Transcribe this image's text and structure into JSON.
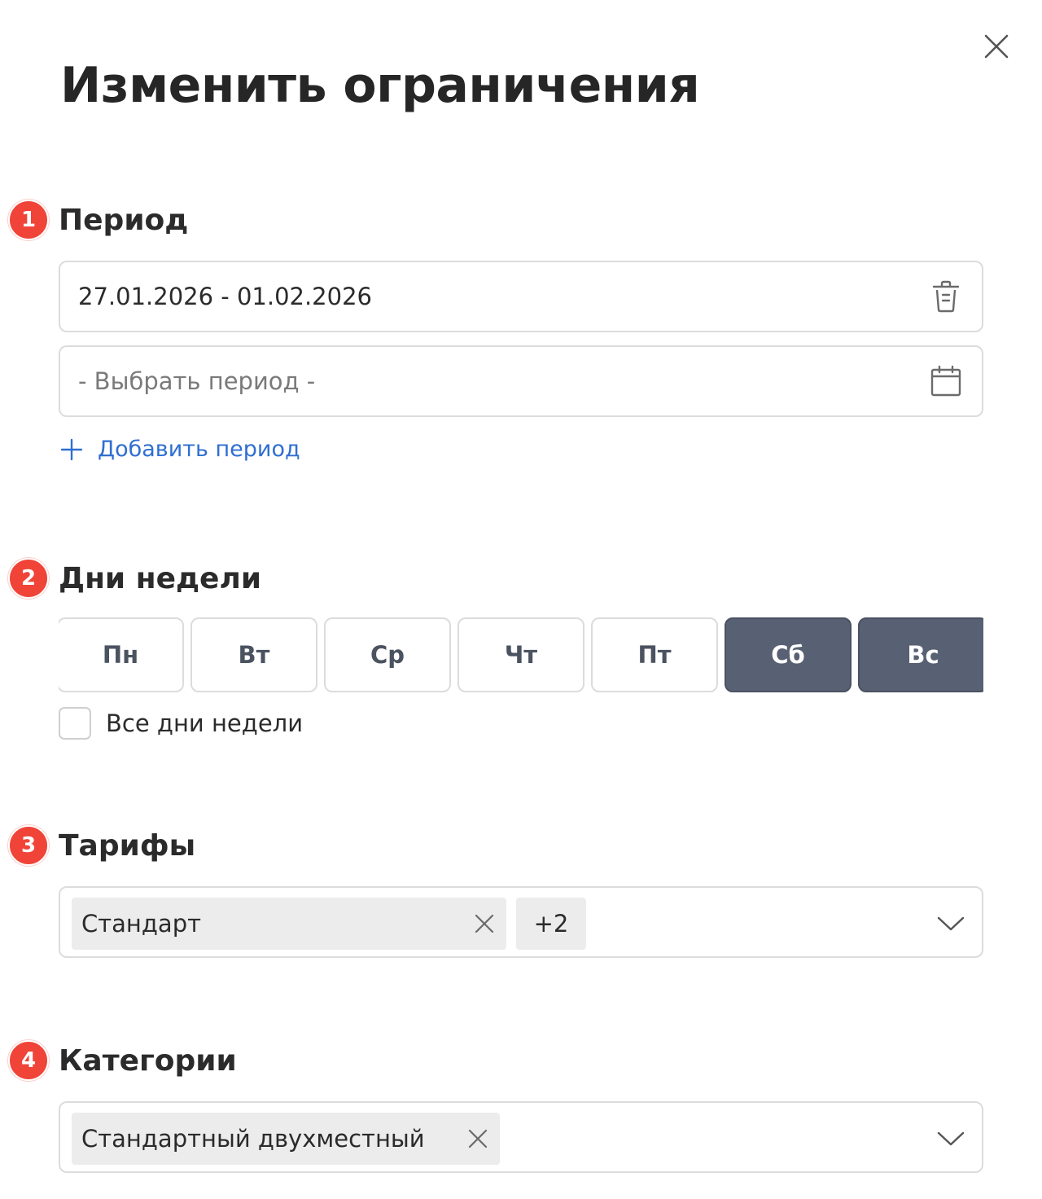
{
  "dialog": {
    "title": "Изменить ограничения",
    "close_icon": "close-icon"
  },
  "sections": {
    "period": {
      "step": "1",
      "title": "Период",
      "selected_value": "27.01.2026 - 01.02.2026",
      "placeholder": "- Выбрать период -",
      "add_label": "Добавить период"
    },
    "weekdays": {
      "step": "2",
      "title": "Дни недели",
      "days": [
        {
          "label": "Пн",
          "selected": false
        },
        {
          "label": "Вт",
          "selected": false
        },
        {
          "label": "Ср",
          "selected": false
        },
        {
          "label": "Чт",
          "selected": false
        },
        {
          "label": "Пт",
          "selected": false
        },
        {
          "label": "Сб",
          "selected": true
        },
        {
          "label": "Вс",
          "selected": true
        }
      ],
      "all_days_label": "Все дни недели",
      "all_days_checked": false
    },
    "tariffs": {
      "step": "3",
      "title": "Тарифы",
      "chip": "Стандарт",
      "more": "+2"
    },
    "categories": {
      "step": "4",
      "title": "Категории",
      "chip": "Стандартный двухместный"
    }
  },
  "colors": {
    "badge": "#f04438",
    "active_day": "#586173",
    "link": "#2f6fd1"
  }
}
